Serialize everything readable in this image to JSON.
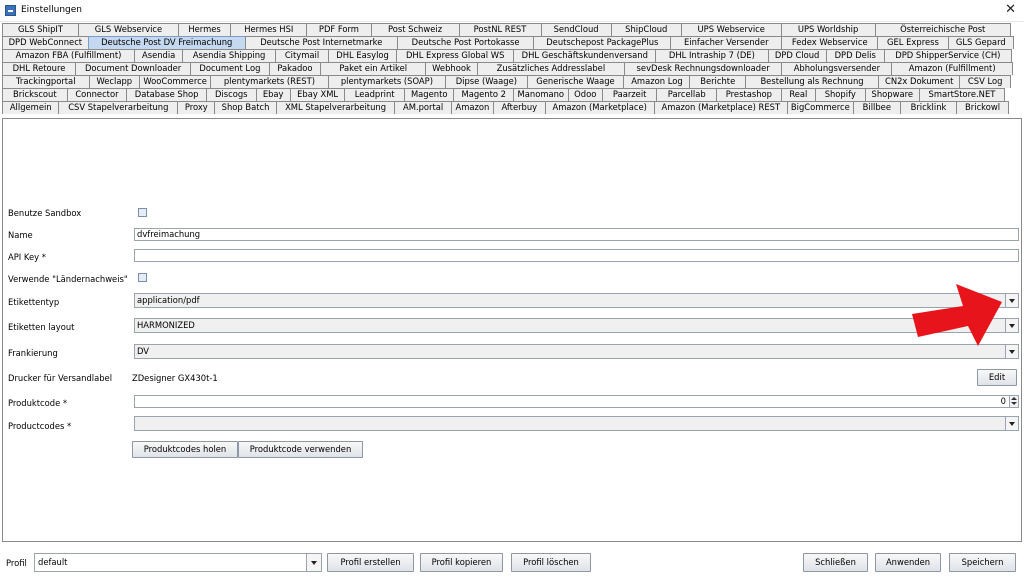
{
  "window": {
    "title": "Einstellungen",
    "close_glyph": "✕"
  },
  "tabs": {
    "rows": [
      [
        "GLS ShipIT",
        "GLS Webservice",
        "Hermes",
        "Hermes HSI",
        "PDF Form",
        "Post Schweiz",
        "PostNL REST",
        "SendCloud",
        "ShipCloud",
        "UPS Webservice",
        "UPS Worldship",
        "Österreichische Post"
      ],
      [
        "DPD WebConnect",
        "Deutsche Post DV Freimachung",
        "Deutsche Post Internetmarke",
        "Deutsche Post Portokasse",
        "Deutschepost PackagePlus",
        "Einfacher Versender",
        "Fedex Webservice",
        "GEL Express",
        "GLS Gepard"
      ],
      [
        "Amazon FBA (Fulfillment)",
        "Asendia",
        "Asendia Shipping",
        "Citymail",
        "DHL Easylog",
        "DHL Express Global WS",
        "DHL Geschäftskundenversand",
        "DHL Intraship 7 (DE)",
        "DPD Cloud",
        "DPD Delis",
        "DPD ShipperService (CH)"
      ],
      [
        "DHL Retoure",
        "Document Downloader",
        "Document Log",
        "Pakadoo",
        "Paket ein Artikel",
        "Webhook",
        "Zusätzliches Addresslabel",
        "sevDesk Rechnungsdownloader",
        "Abholungsversender",
        "Amazon (Fulfillment)"
      ],
      [
        "Trackingportal",
        "Weclapp",
        "WooCommerce",
        "plentymarkets (REST)",
        "plentymarkets (SOAP)",
        "Dipse (Waage)",
        "Generische Waage",
        "Amazon Log",
        "Berichte",
        "Bestellung als Rechnung",
        "CN2x Dokument",
        "CSV Log"
      ],
      [
        "Brickscout",
        "Connector",
        "Database Shop",
        "Discogs",
        "Ebay",
        "Ebay XML",
        "Leadprint",
        "Magento",
        "Magento 2",
        "Manomano",
        "Odoo",
        "Paarzeit",
        "Parcellab",
        "Prestashop",
        "Real",
        "Shopify",
        "Shopware",
        "SmartStore.NET"
      ],
      [
        "Allgemein",
        "CSV Stapelverarbeitung",
        "Proxy",
        "Shop Batch",
        "XML Stapelverarbeitung",
        "AM.portal",
        "Amazon",
        "Afterbuy",
        "Amazon (Marketplace)",
        "Amazon (Marketplace) REST",
        "BigCommerce",
        "Billbee",
        "Bricklink",
        "Brickowl"
      ]
    ],
    "active": "Deutsche Post DV Freimachung"
  },
  "form": {
    "sandbox_label": "Benutze Sandbox",
    "name_label": "Name",
    "name_value": "dvfreimachung",
    "apikey_label": "API Key *",
    "apikey_value": "",
    "laendernachweis_label": "Verwende \"Ländernachweis\"",
    "etikettentyp_label": "Etikettentyp",
    "etikettentyp_value": "application/pdf",
    "layout_label": "Etiketten layout",
    "layout_value": "HARMONIZED",
    "frankierung_label": "Frankierung",
    "frankierung_value": "DV",
    "drucker_label": "Drucker für Versandlabel",
    "drucker_value": "ZDesigner GX430t-1",
    "edit_label": "Edit",
    "produktcode_label": "Produktcode *",
    "produktcode_value": "0",
    "productcodes_label": "Productcodes *",
    "productcodes_value": "",
    "holen_label": "Produktcodes holen",
    "verwenden_label": "Produktcode verwenden"
  },
  "bottom": {
    "profil_label": "Profil",
    "profil_value": "default",
    "erstellen_label": "Profil erstellen",
    "kopieren_label": "Profil kopieren",
    "loeschen_label": "Profil löschen",
    "schliessen_label": "Schließen",
    "anwenden_label": "Anwenden",
    "speichern_label": "Speichern"
  },
  "colors": {
    "annotation_arrow": "#e8141b",
    "active_tab": "#c4d8ef"
  }
}
